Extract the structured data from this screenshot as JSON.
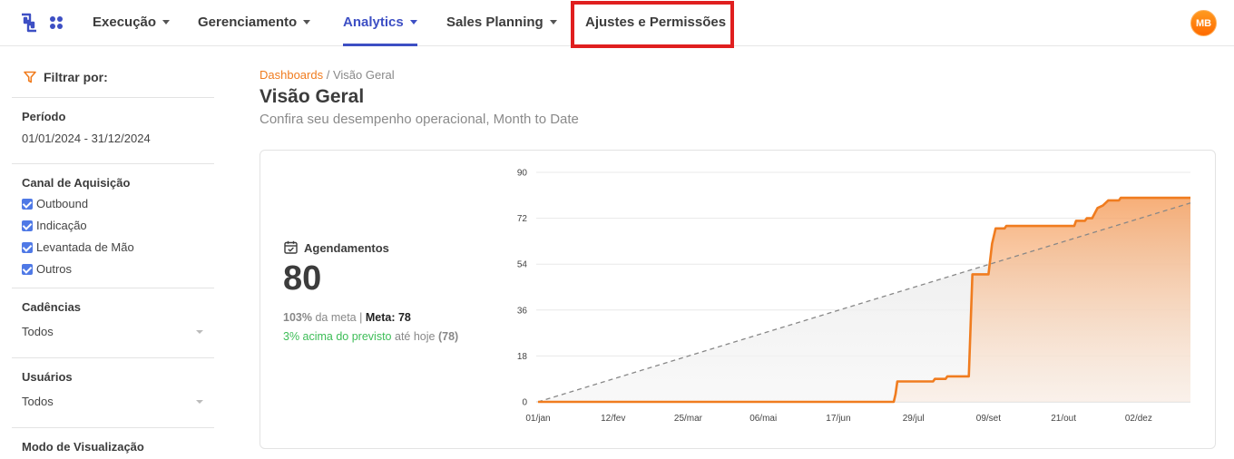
{
  "nav": {
    "items": [
      {
        "label": "Execução",
        "has_caret": true,
        "active": false
      },
      {
        "label": "Gerenciamento",
        "has_caret": true,
        "active": false
      },
      {
        "label": "Analytics",
        "has_caret": true,
        "active": true
      },
      {
        "label": "Sales Planning",
        "has_caret": true,
        "active": false
      },
      {
        "label": "Ajustes e Permissões",
        "has_caret": false,
        "active": false
      }
    ],
    "avatar_initials": "MB",
    "accent_color": "#3d4fc4"
  },
  "sidebar": {
    "filter_title": "Filtrar por:",
    "period": {
      "label": "Período",
      "value": "01/01/2024 - 31/12/2024"
    },
    "channel": {
      "label": "Canal de Aquisição",
      "options": [
        "Outbound",
        "Indicação",
        "Levantada de Mão",
        "Outros"
      ]
    },
    "cadences": {
      "label": "Cadências",
      "value": "Todos"
    },
    "users": {
      "label": "Usuários",
      "value": "Todos"
    },
    "view_mode": {
      "label": "Modo de Visualização"
    }
  },
  "main": {
    "breadcrumb_root": "Dashboards",
    "breadcrumb_sep": "/",
    "breadcrumb_current": "Visão Geral",
    "title": "Visão Geral",
    "subtitle": "Confira seu desempenho operacional, Month to Date"
  },
  "kpi": {
    "label": "Agendamentos",
    "value": "80",
    "pct": "103%",
    "pct_text": "da meta |",
    "meta_label": "Meta: 78",
    "above_text": "3% acima do previsto",
    "until_today": "até hoje",
    "today_value": "(78)"
  },
  "chart_data": {
    "type": "area",
    "x_tick_labels": [
      "01/jan",
      "12/fev",
      "25/mar",
      "06/mai",
      "17/jun",
      "29/jul",
      "09/set",
      "21/out",
      "02/dez"
    ],
    "y_ticks": [
      0,
      18,
      36,
      54,
      72,
      90
    ],
    "ylim": [
      0,
      90
    ],
    "x_range_days": [
      0,
      365
    ],
    "series": [
      {
        "kind": "actual",
        "color": "#f07c1f",
        "points": [
          [
            0,
            0
          ],
          [
            199,
            0
          ],
          [
            200,
            3
          ],
          [
            201,
            8
          ],
          [
            221,
            8
          ],
          [
            222,
            9
          ],
          [
            228,
            9
          ],
          [
            229,
            10
          ],
          [
            241,
            10
          ],
          [
            242,
            30
          ],
          [
            243,
            50
          ],
          [
            252,
            50
          ],
          [
            254,
            62
          ],
          [
            256,
            68
          ],
          [
            261,
            68
          ],
          [
            262,
            69
          ],
          [
            300,
            69
          ],
          [
            301,
            71
          ],
          [
            306,
            71
          ],
          [
            307,
            72
          ],
          [
            310,
            72
          ],
          [
            313,
            76
          ],
          [
            316,
            77
          ],
          [
            319,
            79
          ],
          [
            325,
            79
          ],
          [
            326,
            80
          ],
          [
            365,
            80
          ]
        ]
      },
      {
        "kind": "target",
        "color": "#888888",
        "points": [
          [
            0,
            0
          ],
          [
            365,
            78
          ]
        ]
      }
    ],
    "grid": true
  }
}
